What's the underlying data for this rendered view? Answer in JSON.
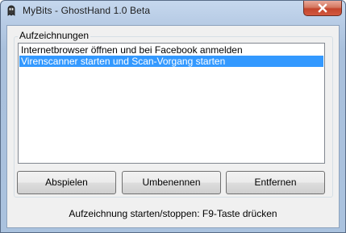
{
  "window": {
    "title": "MyBits - GhostHand 1.0 Beta",
    "close_icon": "close-icon"
  },
  "group": {
    "label": "Aufzeichnungen"
  },
  "list": {
    "items": [
      {
        "text": "Internetbrowser öffnen und bei Facebook anmelden",
        "selected": false
      },
      {
        "text": "Virenscanner starten und Scan-Vorgang starten",
        "selected": true
      }
    ]
  },
  "buttons": {
    "play": "Abspielen",
    "rename": "Umbenennen",
    "remove": "Entfernen"
  },
  "status": {
    "text": "Aufzeichnung starten/stoppen: F9-Taste drücken"
  },
  "colors": {
    "selection": "#3399ff",
    "close_button": "#c4452c"
  }
}
